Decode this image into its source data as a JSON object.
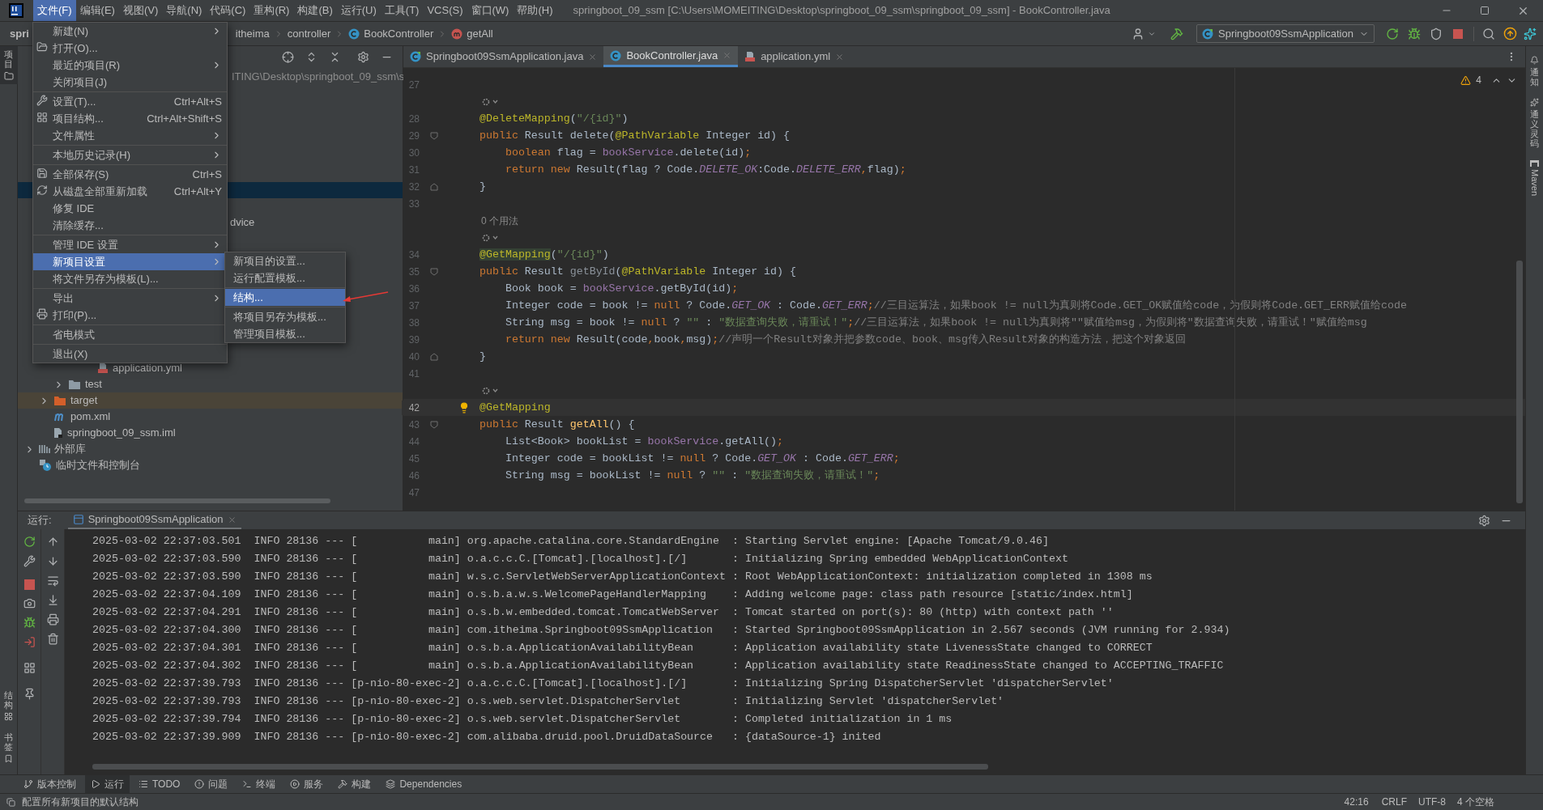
{
  "window": {
    "title": "springboot_09_ssm [C:\\Users\\MOMEITING\\Desktop\\springboot_09_ssm\\springboot_09_ssm] - BookController.java"
  },
  "menu_bar": {
    "items": [
      {
        "label": "文件(F)",
        "selected": true
      },
      {
        "label": "编辑(E)",
        "selected": false
      },
      {
        "label": "视图(V)",
        "selected": false
      },
      {
        "label": "导航(N)",
        "selected": false
      },
      {
        "label": "代码(C)",
        "selected": false
      },
      {
        "label": "重构(R)",
        "selected": false
      },
      {
        "label": "构建(B)",
        "selected": false
      },
      {
        "label": "运行(U)",
        "selected": false
      },
      {
        "label": "工具(T)",
        "selected": false
      },
      {
        "label": "VCS(S)",
        "selected": false
      },
      {
        "label": "窗口(W)",
        "selected": false
      },
      {
        "label": "帮助(H)",
        "selected": false
      }
    ]
  },
  "file_menu": {
    "items": [
      {
        "kind": "item",
        "label": "新建(N)",
        "submenu": true,
        "selected": false
      },
      {
        "kind": "item",
        "label": "打开(O)...",
        "selected": false
      },
      {
        "kind": "item",
        "label": "最近的项目(R)",
        "submenu": true,
        "selected": false
      },
      {
        "kind": "item",
        "label": "关闭项目(J)",
        "selected": false
      },
      {
        "kind": "separator"
      },
      {
        "kind": "item",
        "label": "设置(T)...",
        "shortcut": "Ctrl+Alt+S",
        "selected": false
      },
      {
        "kind": "item",
        "label": "项目结构...",
        "shortcut": "Ctrl+Alt+Shift+S",
        "selected": false
      },
      {
        "kind": "item",
        "label": "文件属性",
        "submenu": true,
        "selected": false
      },
      {
        "kind": "separator"
      },
      {
        "kind": "item",
        "label": "本地历史记录(H)",
        "submenu": true,
        "selected": false
      },
      {
        "kind": "separator"
      },
      {
        "kind": "item",
        "label": "全部保存(S)",
        "shortcut": "Ctrl+S",
        "selected": false
      },
      {
        "kind": "item",
        "label": "从磁盘全部重新加载",
        "shortcut": "Ctrl+Alt+Y",
        "selected": false
      },
      {
        "kind": "item",
        "label": "修复 IDE",
        "selected": false
      },
      {
        "kind": "item",
        "label": "清除缓存...",
        "selected": false
      },
      {
        "kind": "separator"
      },
      {
        "kind": "item",
        "label": "管理 IDE 设置",
        "submenu": true,
        "selected": false
      },
      {
        "kind": "item",
        "label": "新项目设置",
        "submenu": true,
        "selected": true
      },
      {
        "kind": "item",
        "label": "将文件另存为模板(L)...",
        "selected": false
      },
      {
        "kind": "separator"
      },
      {
        "kind": "item",
        "label": "导出",
        "submenu": true,
        "selected": false
      },
      {
        "kind": "item",
        "label": "打印(P)...",
        "selected": false
      },
      {
        "kind": "separator"
      },
      {
        "kind": "item",
        "label": "省电模式",
        "selected": false
      },
      {
        "kind": "separator"
      },
      {
        "kind": "item",
        "label": "退出(X)",
        "selected": false
      }
    ]
  },
  "submenu": {
    "items": [
      {
        "kind": "item",
        "label": "新项目的设置...",
        "selected": false
      },
      {
        "kind": "item",
        "label": "运行配置模板...",
        "selected": false
      },
      {
        "kind": "separator"
      },
      {
        "kind": "item",
        "label": "结构...",
        "selected": true
      },
      {
        "kind": "separator"
      },
      {
        "kind": "item",
        "label": "将项目另存为模板...",
        "selected": false
      },
      {
        "kind": "item",
        "label": "管理项目模板...",
        "selected": false
      }
    ]
  },
  "navigation": {
    "breadcrumb": [
      {
        "label": "spri"
      },
      {
        "label": "itheima"
      },
      {
        "label": "controller"
      },
      {
        "label": "BookController",
        "kind": "class"
      },
      {
        "label": "getAll",
        "kind": "method"
      }
    ],
    "run_config": "Springboot09SsmApplication"
  },
  "project_panel": {
    "path_fragment": "ITING\\Desktop\\springboot_09_ssm\\s",
    "covered_row_fragment": "dvice",
    "tree": [
      {
        "children": [
          {
            "children": [
              {
                "children": [
                  {
                    "children": [
                      {
                        "label": "application.yml",
                        "kind": "yml",
                        "highlighted": false
                      }
                    ]
                  }
                ]
              },
              {
                "label": "test",
                "kind": "folder",
                "expanded": false,
                "highlighted": false
              }
            ]
          },
          {
            "label": "target",
            "kind": "excluded_folder",
            "expanded": false,
            "highlighted": true
          },
          {
            "label": "pom.xml",
            "kind": "maven",
            "highlighted": false
          },
          {
            "label": "springboot_09_ssm.iml",
            "kind": "module",
            "highlighted": false
          }
        ]
      },
      {
        "label": "外部库",
        "kind": "library",
        "expanded": false,
        "highlighted": false
      },
      {
        "label": "临时文件和控制台",
        "kind": "scratches",
        "highlighted": false
      }
    ]
  },
  "editor": {
    "tabs": [
      {
        "label": "Springboot09SsmApplication.java",
        "kind": "app",
        "selected": false
      },
      {
        "label": "BookController.java",
        "kind": "class",
        "selected": true
      },
      {
        "label": "application.yml",
        "kind": "yml",
        "selected": false
      }
    ],
    "warnings": "4",
    "rows": [
      {
        "kind": "code",
        "number": "27",
        "current": false,
        "tokens": []
      },
      {
        "kind": "inlay"
      },
      {
        "kind": "code",
        "number": "28",
        "current": false,
        "tokens": [
          {
            "kind": "ann",
            "text": "@DeleteMapping"
          },
          {
            "kind": "plain",
            "text": "("
          },
          {
            "kind": "str",
            "text": "\"/{id}\""
          },
          {
            "kind": "plain",
            "text": ")"
          }
        ]
      },
      {
        "kind": "code",
        "number": "29",
        "current": false,
        "fold_start": true,
        "tokens": [
          {
            "kind": "kw",
            "text": "public "
          },
          {
            "kind": "plain",
            "text": "Result delete("
          },
          {
            "kind": "ann",
            "text": "@PathVariable"
          },
          {
            "kind": "plain",
            "text": " Integer id) {"
          }
        ]
      },
      {
        "kind": "code",
        "number": "30",
        "current": false,
        "tokens": [
          {
            "kind": "kw",
            "text": "    boolean"
          },
          {
            "kind": "plain",
            "text": " flag = "
          },
          {
            "kind": "field",
            "text": "bookService"
          },
          {
            "kind": "plain",
            "text": ".delete(id)"
          },
          {
            "kind": "kw",
            "text": ";"
          }
        ]
      },
      {
        "kind": "code",
        "number": "31",
        "current": false,
        "tokens": [
          {
            "kind": "kw",
            "text": "    return new"
          },
          {
            "kind": "plain",
            "text": " Result(flag ? Code."
          },
          {
            "kind": "static",
            "text": "DELETE_OK"
          },
          {
            "kind": "plain",
            "text": ":Code."
          },
          {
            "kind": "static",
            "text": "DELETE_ERR"
          },
          {
            "kind": "kw",
            "text": ","
          },
          {
            "kind": "plain",
            "text": "flag)"
          },
          {
            "kind": "kw",
            "text": ";"
          }
        ]
      },
      {
        "kind": "code",
        "number": "32",
        "current": false,
        "fold_end": true,
        "tokens": [
          {
            "kind": "plain",
            "text": "}"
          }
        ]
      },
      {
        "kind": "code",
        "number": "33",
        "current": false,
        "tokens": []
      },
      {
        "kind": "hint",
        "text": "0 个用法"
      },
      {
        "kind": "inlay"
      },
      {
        "kind": "code",
        "number": "34",
        "current": false,
        "tokens": [
          {
            "kind": "ann_hl",
            "text": "@GetMapping"
          },
          {
            "kind": "plain",
            "text": "("
          },
          {
            "kind": "str",
            "text": "\"/{id}\""
          },
          {
            "kind": "plain",
            "text": ")"
          }
        ]
      },
      {
        "kind": "code",
        "number": "35",
        "current": false,
        "fold_start": true,
        "tokens": [
          {
            "kind": "kw",
            "text": "public "
          },
          {
            "kind": "plain",
            "text": "Result "
          },
          {
            "kind": "unused",
            "text": "getById"
          },
          {
            "kind": "plain",
            "text": "("
          },
          {
            "kind": "ann",
            "text": "@PathVariable"
          },
          {
            "kind": "plain",
            "text": " Integer id) {"
          }
        ]
      },
      {
        "kind": "code",
        "number": "36",
        "current": false,
        "tokens": [
          {
            "kind": "plain",
            "text": "    Book book = "
          },
          {
            "kind": "field",
            "text": "bookService"
          },
          {
            "kind": "plain",
            "text": ".getById(id)"
          },
          {
            "kind": "kw",
            "text": ";"
          }
        ]
      },
      {
        "kind": "code",
        "number": "37",
        "current": false,
        "tokens": [
          {
            "kind": "plain",
            "text": "    Integer code = book != "
          },
          {
            "kind": "kw",
            "text": "null"
          },
          {
            "kind": "plain",
            "text": " ? Code."
          },
          {
            "kind": "static",
            "text": "GET_OK"
          },
          {
            "kind": "plain",
            "text": " : Code."
          },
          {
            "kind": "static",
            "text": "GET_ERR"
          },
          {
            "kind": "kw",
            "text": ";"
          },
          {
            "kind": "comment",
            "text": "//三目运算法，如果book != null为真则将Code.GET_OK赋值给code，为假则将Code.GET_ERR赋值给code"
          }
        ]
      },
      {
        "kind": "code",
        "number": "38",
        "current": false,
        "tokens": [
          {
            "kind": "plain",
            "text": "    String msg = book != "
          },
          {
            "kind": "kw",
            "text": "null"
          },
          {
            "kind": "plain",
            "text": " ? "
          },
          {
            "kind": "str",
            "text": "\"\""
          },
          {
            "kind": "plain",
            "text": " : "
          },
          {
            "kind": "str",
            "text": "\"数据查询失败，请重试！\""
          },
          {
            "kind": "kw",
            "text": ";"
          },
          {
            "kind": "comment",
            "text": "//三目运算法，如果book != null为真则将\"\"赋值给msg，为假则将\"数据查询失败，请重试！\"赋值给msg"
          }
        ]
      },
      {
        "kind": "code",
        "number": "39",
        "current": false,
        "tokens": [
          {
            "kind": "kw",
            "text": "    return new"
          },
          {
            "kind": "plain",
            "text": " Result(code"
          },
          {
            "kind": "kw",
            "text": ","
          },
          {
            "kind": "plain",
            "text": "book"
          },
          {
            "kind": "kw",
            "text": ","
          },
          {
            "kind": "plain",
            "text": "msg)"
          },
          {
            "kind": "kw",
            "text": ";"
          },
          {
            "kind": "comment",
            "text": "//声明一个Result对象并把参数code、book、msg传入Result对象的构造方法，把这个对象返回"
          }
        ]
      },
      {
        "kind": "code",
        "number": "40",
        "current": false,
        "fold_end": true,
        "tokens": [
          {
            "kind": "plain",
            "text": "}"
          }
        ]
      },
      {
        "kind": "code",
        "number": "41",
        "current": false,
        "tokens": []
      },
      {
        "kind": "inlay"
      },
      {
        "kind": "code",
        "number": "42",
        "current": true,
        "bulb": true,
        "tokens": [
          {
            "kind": "ann",
            "text": "@GetMapping"
          }
        ]
      },
      {
        "kind": "code",
        "number": "43",
        "current": false,
        "fold_start": true,
        "tokens": [
          {
            "kind": "kw",
            "text": "public "
          },
          {
            "kind": "plain",
            "text": "Result "
          },
          {
            "kind": "method",
            "text": "getAll"
          },
          {
            "kind": "plain",
            "text": "() {"
          }
        ]
      },
      {
        "kind": "code",
        "number": "44",
        "current": false,
        "tokens": [
          {
            "kind": "plain",
            "text": "    List<Book> bookList = "
          },
          {
            "kind": "field",
            "text": "bookService"
          },
          {
            "kind": "plain",
            "text": ".getAll()"
          },
          {
            "kind": "kw",
            "text": ";"
          }
        ]
      },
      {
        "kind": "code",
        "number": "45",
        "current": false,
        "tokens": [
          {
            "kind": "plain",
            "text": "    Integer code = bookList != "
          },
          {
            "kind": "kw",
            "text": "null"
          },
          {
            "kind": "plain",
            "text": " ? Code."
          },
          {
            "kind": "static",
            "text": "GET_OK"
          },
          {
            "kind": "plain",
            "text": " : Code."
          },
          {
            "kind": "static",
            "text": "GET_ERR"
          },
          {
            "kind": "kw",
            "text": ";"
          }
        ]
      },
      {
        "kind": "code",
        "number": "46",
        "current": false,
        "tokens": [
          {
            "kind": "plain",
            "text": "    String msg = bookList != "
          },
          {
            "kind": "kw",
            "text": "null"
          },
          {
            "kind": "plain",
            "text": " ? "
          },
          {
            "kind": "str",
            "text": "\"\""
          },
          {
            "kind": "plain",
            "text": " : "
          },
          {
            "kind": "str",
            "text": "\"数据查询失败，请重试！\""
          },
          {
            "kind": "kw",
            "text": ";"
          }
        ]
      },
      {
        "kind": "code",
        "number": "47",
        "current": false,
        "tokens": []
      }
    ]
  },
  "run_panel": {
    "label": "运行:",
    "tab": "Springboot09SsmApplication",
    "console_lines": [
      "2025-03-02 22:37:03.501  INFO 28136 --- [           main] org.apache.catalina.core.StandardEngine  : Starting Servlet engine: [Apache Tomcat/9.0.46]",
      "2025-03-02 22:37:03.590  INFO 28136 --- [           main] o.a.c.c.C.[Tomcat].[localhost].[/]       : Initializing Spring embedded WebApplicationContext",
      "2025-03-02 22:37:03.590  INFO 28136 --- [           main] w.s.c.ServletWebServerApplicationContext : Root WebApplicationContext: initialization completed in 1308 ms",
      "2025-03-02 22:37:04.109  INFO 28136 --- [           main] o.s.b.a.w.s.WelcomePageHandlerMapping    : Adding welcome page: class path resource [static/index.html]",
      "2025-03-02 22:37:04.291  INFO 28136 --- [           main] o.s.b.w.embedded.tomcat.TomcatWebServer  : Tomcat started on port(s): 80 (http) with context path ''",
      "2025-03-02 22:37:04.300  INFO 28136 --- [           main] com.itheima.Springboot09SsmApplication   : Started Springboot09SsmApplication in 2.567 seconds (JVM running for 2.934)",
      "2025-03-02 22:37:04.301  INFO 28136 --- [           main] o.s.b.a.ApplicationAvailabilityBean      : Application availability state LivenessState changed to CORRECT",
      "2025-03-02 22:37:04.302  INFO 28136 --- [           main] o.s.b.a.ApplicationAvailabilityBean      : Application availability state ReadinessState changed to ACCEPTING_TRAFFIC",
      "2025-03-02 22:37:39.793  INFO 28136 --- [p-nio-80-exec-2] o.a.c.c.C.[Tomcat].[localhost].[/]       : Initializing Spring DispatcherServlet 'dispatcherServlet'",
      "2025-03-02 22:37:39.793  INFO 28136 --- [p-nio-80-exec-2] o.s.web.servlet.DispatcherServlet        : Initializing Servlet 'dispatcherServlet'",
      "2025-03-02 22:37:39.794  INFO 28136 --- [p-nio-80-exec-2] o.s.web.servlet.DispatcherServlet        : Completed initialization in 1 ms",
      "2025-03-02 22:37:39.909  INFO 28136 --- [p-nio-80-exec-2] com.alibaba.druid.pool.DruidDataSource   : {dataSource-1} inited"
    ]
  },
  "left_strip": {
    "top": "项目",
    "bottom": [
      "结构",
      "书签"
    ]
  },
  "right_strip": [
    "通知",
    "通义灵码",
    "Maven"
  ],
  "tool_windows": [
    {
      "label": "版本控制",
      "selected": false
    },
    {
      "label": "运行",
      "selected": true
    },
    {
      "label": "TODO",
      "selected": false
    },
    {
      "label": "问题",
      "selected": false
    },
    {
      "label": "终端",
      "selected": false
    },
    {
      "label": "服务",
      "selected": false
    },
    {
      "label": "构建",
      "selected": false
    },
    {
      "label": "Dependencies",
      "selected": false
    }
  ],
  "status_bar": {
    "message": "配置所有新项目的默认结构",
    "position": "42:16",
    "line_separator": "CRLF",
    "encoding": "UTF-8",
    "indent": "4 个空格"
  }
}
